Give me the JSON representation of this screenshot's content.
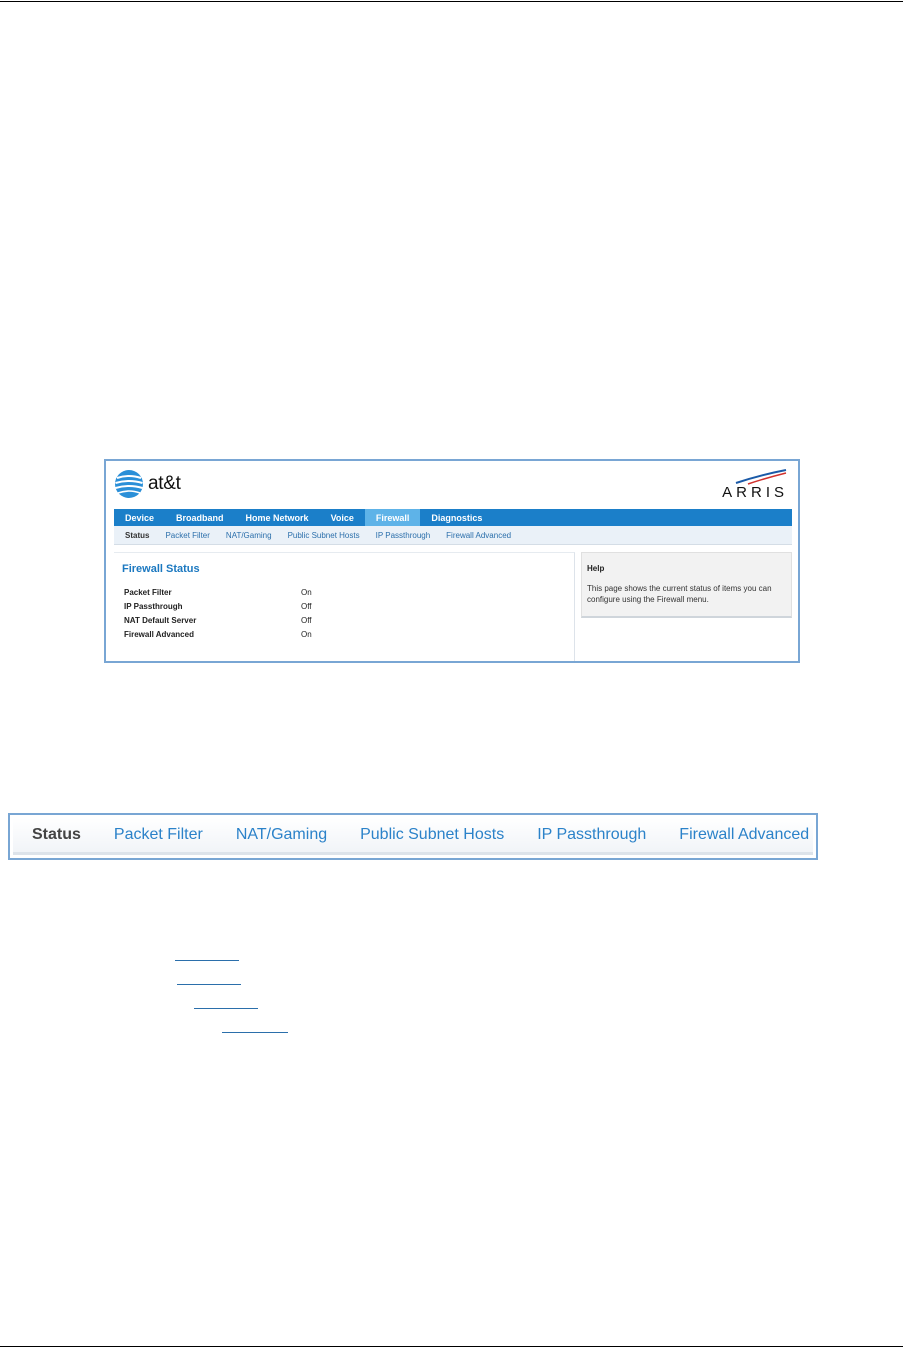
{
  "brand": {
    "name": "at&t",
    "partner": "ARRIS",
    "brand_color": "#1b7fc9",
    "accent_color": "#5eb3e8"
  },
  "nav": {
    "tabs": [
      {
        "label": "Device",
        "active": false
      },
      {
        "label": "Broadband",
        "active": false
      },
      {
        "label": "Home Network",
        "active": false
      },
      {
        "label": "Voice",
        "active": false
      },
      {
        "label": "Firewall",
        "active": true
      },
      {
        "label": "Diagnostics",
        "active": false
      }
    ],
    "subtabs": [
      {
        "label": "Status",
        "active": true
      },
      {
        "label": "Packet Filter",
        "active": false
      },
      {
        "label": "NAT/Gaming",
        "active": false
      },
      {
        "label": "Public Subnet Hosts",
        "active": false
      },
      {
        "label": "IP Passthrough",
        "active": false
      },
      {
        "label": "Firewall Advanced",
        "active": false
      }
    ]
  },
  "firewall_status": {
    "title": "Firewall Status",
    "rows": [
      {
        "label": "Packet Filter",
        "value": "On"
      },
      {
        "label": "IP Passthrough",
        "value": "Off"
      },
      {
        "label": "NAT Default Server",
        "value": "Off"
      },
      {
        "label": "Firewall Advanced",
        "value": "On"
      }
    ]
  },
  "help": {
    "title": "Help",
    "text": "This page shows the current status of items you can configure using the Firewall menu."
  },
  "zoomed_subnav": {
    "items": [
      {
        "label": "Status",
        "active": true
      },
      {
        "label": "Packet Filter",
        "active": false
      },
      {
        "label": "NAT/Gaming",
        "active": false
      },
      {
        "label": "Public Subnet Hosts",
        "active": false
      },
      {
        "label": "IP Passthrough",
        "active": false
      },
      {
        "label": "Firewall Advanced",
        "active": false
      }
    ]
  }
}
